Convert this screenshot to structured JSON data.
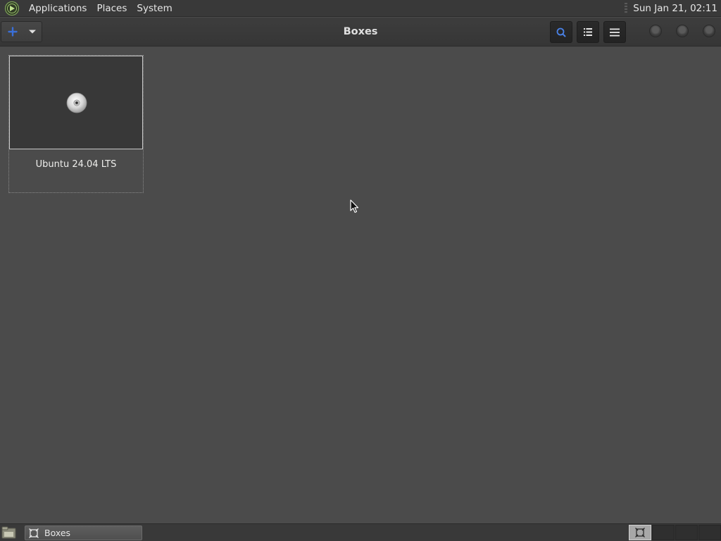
{
  "top_panel": {
    "menus": [
      "Applications",
      "Places",
      "System"
    ],
    "clock": "Sun Jan 21, 02:11"
  },
  "header": {
    "title": "Boxes",
    "new_button_icon": "plus-icon",
    "new_menu_icon": "chevron-down-icon",
    "search_icon": "search-icon",
    "list_view_icon": "list-view-icon",
    "menu_icon": "hamburger-menu-icon",
    "accent": "#3a6fd8"
  },
  "boxes": [
    {
      "name": "Ubuntu 24.04 LTS",
      "icon": "cdrom-disc-icon"
    }
  ],
  "taskbar": {
    "tasks": [
      {
        "label": "Boxes",
        "icon": "boxes-app-icon"
      }
    ],
    "workspace_count": 4,
    "active_workspace": 1
  }
}
